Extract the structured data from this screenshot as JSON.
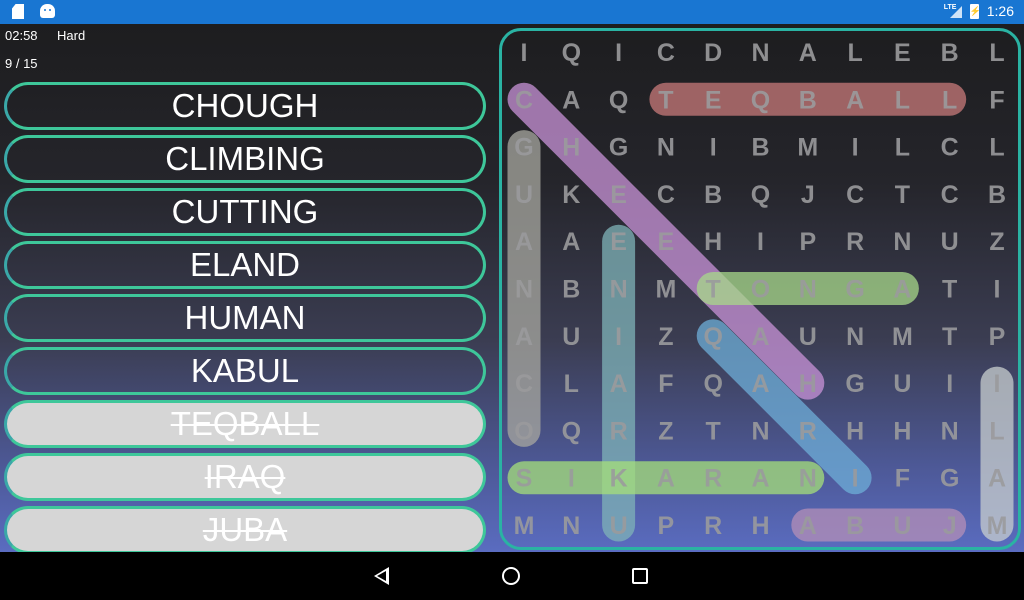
{
  "status_bar": {
    "left_icons": [
      "sd-card-icon",
      "android-icon"
    ],
    "network": "LTE",
    "battery": "charging",
    "time": "1:26"
  },
  "game": {
    "timer": "02:58",
    "difficulty": "Hard",
    "progress": "9 / 15",
    "words_found": 9,
    "words_total": 15
  },
  "word_list": [
    {
      "word": "CHOUGH",
      "found": false
    },
    {
      "word": "CLIMBING",
      "found": false
    },
    {
      "word": "CUTTING",
      "found": false
    },
    {
      "word": "ELAND",
      "found": false
    },
    {
      "word": "HUMAN",
      "found": false
    },
    {
      "word": "KABUL",
      "found": false
    },
    {
      "word": "TEQBALL",
      "found": true
    },
    {
      "word": "IRAQ",
      "found": true
    },
    {
      "word": "JUBA",
      "found": true
    }
  ],
  "grid": {
    "rows": [
      "IQICDNALEBL",
      "CAQTEQBALLF",
      "GHGNIBMILCL",
      "UKECBQJCTCB",
      "AAEEHIPRNUZ",
      "NBNMTONGATI",
      "AUIZQAUNMTP",
      "CLAFQAHGUII",
      "OQRZTNRHHNL",
      "SIKARANIFGA",
      "MNUPRHABUJM"
    ],
    "highlights": [
      {
        "from": [
          1,
          3
        ],
        "to": [
          1,
          9
        ],
        "color": "#c87a7a"
      },
      {
        "from": [
          2,
          0
        ],
        "to": [
          8,
          0
        ],
        "color": "#a8a8a0"
      },
      {
        "from": [
          1,
          0
        ],
        "to": [
          7,
          6
        ],
        "color": "#c993d8"
      },
      {
        "from": [
          4,
          2
        ],
        "to": [
          10,
          2
        ],
        "color": "#7fb3b8"
      },
      {
        "from": [
          5,
          4
        ],
        "to": [
          5,
          8
        ],
        "color": "#a8d98a"
      },
      {
        "from": [
          6,
          4
        ],
        "to": [
          9,
          7
        ],
        "color": "#6eaed8"
      },
      {
        "from": [
          9,
          0
        ],
        "to": [
          9,
          6
        ],
        "color": "#a6e07a"
      },
      {
        "from": [
          7,
          10
        ],
        "to": [
          10,
          10
        ],
        "color": "#c9cfcf"
      },
      {
        "from": [
          10,
          6
        ],
        "to": [
          10,
          9
        ],
        "color": "#b58fb8"
      }
    ]
  },
  "nav_bar": {
    "buttons": [
      "back",
      "home",
      "recents"
    ]
  }
}
